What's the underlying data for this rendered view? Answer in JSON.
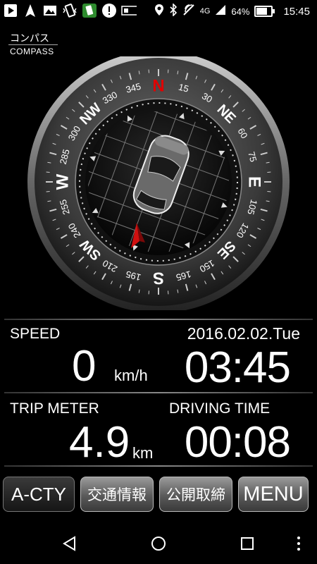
{
  "status_bar": {
    "network": "4G",
    "battery": "64%",
    "battery_level": 0.64,
    "time": "15:45",
    "icons": [
      "play-icon",
      "navigation-arrow-icon",
      "image-icon",
      "vibrate-icon",
      "app-badge-icon",
      "alert-icon",
      "card-icon",
      "location-pin-icon",
      "bluetooth-icon",
      "nfc-icon",
      "signal-icon",
      "battery-icon"
    ]
  },
  "compass": {
    "label_jp": "コンパス",
    "label_en": "COMPASS",
    "cardinals": {
      "n": "N",
      "ne": "NE",
      "e": "E",
      "se": "SE",
      "s": "S",
      "sw": "SW",
      "w": "W",
      "nw": "NW"
    },
    "degrees": [
      "15",
      "30",
      "60",
      "75",
      "105",
      "120",
      "150",
      "165",
      "195",
      "210",
      "240",
      "255",
      "285",
      "300",
      "330",
      "345"
    ],
    "heading_deg": 200
  },
  "speed": {
    "label": "SPEED",
    "value": "0",
    "unit": "km/h"
  },
  "date": "2016.02.02.Tue",
  "clock": "03:45",
  "trip": {
    "label": "TRIP METER",
    "value": "4.9",
    "unit": "km"
  },
  "driving_time": {
    "label": "DRIVING TIME",
    "value": "00:08"
  },
  "buttons": {
    "acty": "A-CTY",
    "traffic": "交通情報",
    "enforcement": "公開取締",
    "menu": "MENU"
  },
  "nav": [
    "back-icon",
    "home-icon",
    "recents-icon",
    "more-icon"
  ]
}
